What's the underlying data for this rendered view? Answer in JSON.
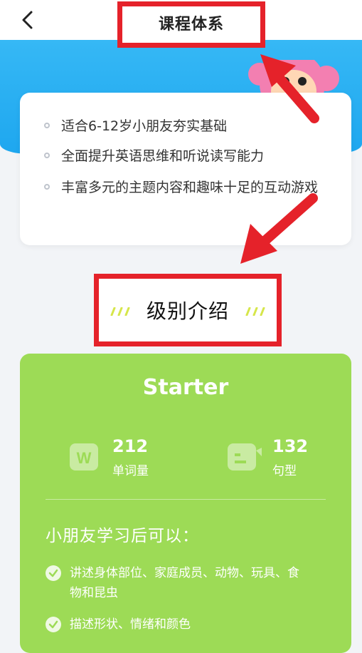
{
  "header": {
    "title": "课程体系"
  },
  "intro": {
    "items": [
      "适合6-12岁小朋友夯实基础",
      "全面提升英语思维和听说读写能力",
      "丰富多元的主题内容和趣味十足的互动游戏"
    ]
  },
  "section": {
    "title": "级别介绍"
  },
  "level": {
    "name": "Starter",
    "stats": [
      {
        "value": "212",
        "label": "单词量",
        "icon": "word-card-icon"
      },
      {
        "value": "132",
        "label": "句型",
        "icon": "sentence-bubble-icon"
      }
    ],
    "learn_title": "小朋友学习后可以：",
    "learn_items": [
      "讲述身体部位、家庭成员、动物、玩具、食物和昆虫",
      "描述形状、情绪和颜色"
    ]
  },
  "colors": {
    "banner": "#1ea7ef",
    "card_green": "#9ddb56",
    "highlight_red": "#e5222a"
  }
}
